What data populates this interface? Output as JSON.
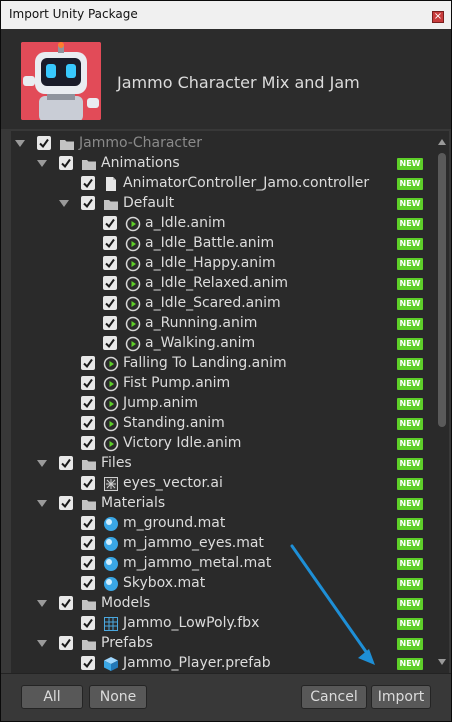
{
  "window": {
    "title": "Import Unity Package",
    "close_glyph": "×"
  },
  "header": {
    "package_name": "Jammo Character Mix and Jam"
  },
  "badge_text": "NEW",
  "colors": {
    "badge": "#5ecf29",
    "arrow": "#1e8fd6",
    "window_bg": "#383838",
    "tree_bg": "#2a2a2a"
  },
  "tree": [
    {
      "label": "Jammo-Character",
      "depth": 0,
      "kind": "folder",
      "fold": true,
      "dim": true,
      "badge": false
    },
    {
      "label": "Animations",
      "depth": 1,
      "kind": "folder",
      "fold": true,
      "badge": true
    },
    {
      "label": "AnimatorController_Jamo.controller",
      "depth": 2,
      "kind": "file",
      "fold": false,
      "badge": true
    },
    {
      "label": "Default",
      "depth": 2,
      "kind": "folder",
      "fold": true,
      "badge": true
    },
    {
      "label": "a_Idle.anim",
      "depth": 3,
      "kind": "anim",
      "fold": false,
      "badge": true
    },
    {
      "label": "a_Idle_Battle.anim",
      "depth": 3,
      "kind": "anim",
      "fold": false,
      "badge": true
    },
    {
      "label": "a_Idle_Happy.anim",
      "depth": 3,
      "kind": "anim",
      "fold": false,
      "badge": true
    },
    {
      "label": "a_Idle_Relaxed.anim",
      "depth": 3,
      "kind": "anim",
      "fold": false,
      "badge": true
    },
    {
      "label": "a_Idle_Scared.anim",
      "depth": 3,
      "kind": "anim",
      "fold": false,
      "badge": true
    },
    {
      "label": "a_Running.anim",
      "depth": 3,
      "kind": "anim",
      "fold": false,
      "badge": true
    },
    {
      "label": "a_Walking.anim",
      "depth": 3,
      "kind": "anim",
      "fold": false,
      "badge": true
    },
    {
      "label": "Falling To Landing.anim",
      "depth": 2,
      "kind": "anim",
      "fold": false,
      "badge": true
    },
    {
      "label": "Fist Pump.anim",
      "depth": 2,
      "kind": "anim",
      "fold": false,
      "badge": true
    },
    {
      "label": "Jump.anim",
      "depth": 2,
      "kind": "anim",
      "fold": false,
      "badge": true
    },
    {
      "label": "Standing.anim",
      "depth": 2,
      "kind": "anim",
      "fold": false,
      "badge": true
    },
    {
      "label": "Victory Idle.anim",
      "depth": 2,
      "kind": "anim",
      "fold": false,
      "badge": true
    },
    {
      "label": "Files",
      "depth": 1,
      "kind": "folder",
      "fold": true,
      "badge": true
    },
    {
      "label": "eyes_vector.ai",
      "depth": 2,
      "kind": "vector",
      "fold": false,
      "badge": true
    },
    {
      "label": "Materials",
      "depth": 1,
      "kind": "folder",
      "fold": true,
      "badge": true
    },
    {
      "label": "m_ground.mat",
      "depth": 2,
      "kind": "material",
      "fold": false,
      "badge": true
    },
    {
      "label": "m_jammo_eyes.mat",
      "depth": 2,
      "kind": "material",
      "fold": false,
      "badge": true
    },
    {
      "label": "m_jammo_metal.mat",
      "depth": 2,
      "kind": "material",
      "fold": false,
      "badge": true
    },
    {
      "label": "Skybox.mat",
      "depth": 2,
      "kind": "material",
      "fold": false,
      "badge": true
    },
    {
      "label": "Models",
      "depth": 1,
      "kind": "folder",
      "fold": true,
      "badge": true
    },
    {
      "label": "Jammo_LowPoly.fbx",
      "depth": 2,
      "kind": "mesh",
      "fold": false,
      "badge": true
    },
    {
      "label": "Prefabs",
      "depth": 1,
      "kind": "folder",
      "fold": true,
      "badge": true
    },
    {
      "label": "Jammo_Player.prefab",
      "depth": 2,
      "kind": "prefab",
      "fold": false,
      "badge": true
    }
  ],
  "footer": {
    "all_label": "All",
    "none_label": "None",
    "cancel_label": "Cancel",
    "import_label": "Import"
  }
}
